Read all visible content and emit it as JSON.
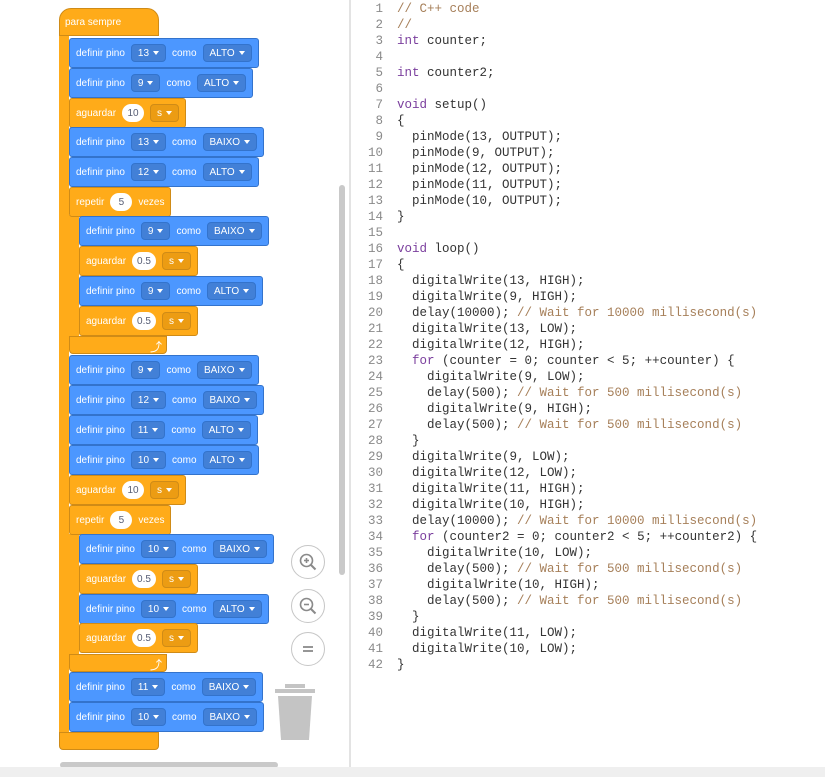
{
  "blocks": {
    "hat_label": "para sempre",
    "set_pin_label": "definir pino",
    "as_label": "como",
    "wait_label": "aguardar",
    "repeat_label": "repetir",
    "times_label": "vezes",
    "seconds_unit": "s",
    "rows": [
      {
        "kind": "pin",
        "pin": "13",
        "state": "ALTO"
      },
      {
        "kind": "pin",
        "pin": "9",
        "state": "ALTO"
      },
      {
        "kind": "wait",
        "value": "10"
      },
      {
        "kind": "pin",
        "pin": "13",
        "state": "BAIXO"
      },
      {
        "kind": "pin",
        "pin": "12",
        "state": "ALTO"
      },
      {
        "kind": "repeat",
        "count": "5"
      },
      {
        "kind": "pin",
        "pin": "9",
        "state": "BAIXO"
      },
      {
        "kind": "wait",
        "value": "0.5"
      },
      {
        "kind": "pin",
        "pin": "9",
        "state": "ALTO"
      },
      {
        "kind": "wait",
        "value": "0.5"
      },
      {
        "kind": "pin",
        "pin": "9",
        "state": "BAIXO"
      },
      {
        "kind": "pin",
        "pin": "12",
        "state": "BAIXO"
      },
      {
        "kind": "pin",
        "pin": "11",
        "state": "ALTO"
      },
      {
        "kind": "pin",
        "pin": "10",
        "state": "ALTO"
      },
      {
        "kind": "wait",
        "value": "10"
      },
      {
        "kind": "repeat",
        "count": "5"
      },
      {
        "kind": "pin",
        "pin": "10",
        "state": "BAIXO"
      },
      {
        "kind": "wait",
        "value": "0.5"
      },
      {
        "kind": "pin",
        "pin": "10",
        "state": "ALTO"
      },
      {
        "kind": "wait",
        "value": "0.5"
      },
      {
        "kind": "pin",
        "pin": "11",
        "state": "BAIXO"
      },
      {
        "kind": "pin",
        "pin": "10",
        "state": "BAIXO"
      }
    ]
  },
  "zoom": {
    "zoom_in": "zoom-in-icon",
    "zoom_out": "zoom-out-icon",
    "reset": "zoom-reset-icon"
  },
  "code": {
    "lines": [
      [
        [
          "comment",
          "// C++ code"
        ]
      ],
      [
        [
          "comment",
          "//"
        ]
      ],
      [
        [
          "kw",
          "int"
        ],
        [
          "plain",
          " counter;"
        ]
      ],
      [],
      [
        [
          "kw",
          "int"
        ],
        [
          "plain",
          " counter2;"
        ]
      ],
      [],
      [
        [
          "kw",
          "void"
        ],
        [
          "plain",
          " setup()"
        ]
      ],
      [
        [
          "plain",
          "{"
        ]
      ],
      [
        [
          "plain",
          "  pinMode(13, OUTPUT);"
        ]
      ],
      [
        [
          "plain",
          "  pinMode(9, OUTPUT);"
        ]
      ],
      [
        [
          "plain",
          "  pinMode(12, OUTPUT);"
        ]
      ],
      [
        [
          "plain",
          "  pinMode(11, OUTPUT);"
        ]
      ],
      [
        [
          "plain",
          "  pinMode(10, OUTPUT);"
        ]
      ],
      [
        [
          "plain",
          "}"
        ]
      ],
      [],
      [
        [
          "kw",
          "void"
        ],
        [
          "plain",
          " loop()"
        ]
      ],
      [
        [
          "plain",
          "{"
        ]
      ],
      [
        [
          "plain",
          "  digitalWrite(13, HIGH);"
        ]
      ],
      [
        [
          "plain",
          "  digitalWrite(9, HIGH);"
        ]
      ],
      [
        [
          "plain",
          "  delay(10000); "
        ],
        [
          "comment",
          "// Wait for 10000 millisecond(s)"
        ]
      ],
      [
        [
          "plain",
          "  digitalWrite(13, LOW);"
        ]
      ],
      [
        [
          "plain",
          "  digitalWrite(12, HIGH);"
        ]
      ],
      [
        [
          "plain",
          "  "
        ],
        [
          "kw",
          "for"
        ],
        [
          "plain",
          " (counter = 0; counter < 5; ++counter) {"
        ]
      ],
      [
        [
          "plain",
          "    digitalWrite(9, LOW);"
        ]
      ],
      [
        [
          "plain",
          "    delay(500); "
        ],
        [
          "comment",
          "// Wait for 500 millisecond(s)"
        ]
      ],
      [
        [
          "plain",
          "    digitalWrite(9, HIGH);"
        ]
      ],
      [
        [
          "plain",
          "    delay(500); "
        ],
        [
          "comment",
          "// Wait for 500 millisecond(s)"
        ]
      ],
      [
        [
          "plain",
          "  }"
        ]
      ],
      [
        [
          "plain",
          "  digitalWrite(9, LOW);"
        ]
      ],
      [
        [
          "plain",
          "  digitalWrite(12, LOW);"
        ]
      ],
      [
        [
          "plain",
          "  digitalWrite(11, HIGH);"
        ]
      ],
      [
        [
          "plain",
          "  digitalWrite(10, HIGH);"
        ]
      ],
      [
        [
          "plain",
          "  delay(10000); "
        ],
        [
          "comment",
          "// Wait for 10000 millisecond(s)"
        ]
      ],
      [
        [
          "plain",
          "  "
        ],
        [
          "kw",
          "for"
        ],
        [
          "plain",
          " (counter2 = 0; counter2 < 5; ++counter2) {"
        ]
      ],
      [
        [
          "plain",
          "    digitalWrite(10, LOW);"
        ]
      ],
      [
        [
          "plain",
          "    delay(500); "
        ],
        [
          "comment",
          "// Wait for 500 millisecond(s)"
        ]
      ],
      [
        [
          "plain",
          "    digitalWrite(10, HIGH);"
        ]
      ],
      [
        [
          "plain",
          "    delay(500); "
        ],
        [
          "comment",
          "// Wait for 500 millisecond(s)"
        ]
      ],
      [
        [
          "plain",
          "  }"
        ]
      ],
      [
        [
          "plain",
          "  digitalWrite(11, LOW);"
        ]
      ],
      [
        [
          "plain",
          "  digitalWrite(10, LOW);"
        ]
      ],
      [
        [
          "plain",
          "}"
        ]
      ]
    ]
  },
  "colors": {
    "block_blue": "#4c97ff",
    "block_orange": "#ffab19",
    "code_comment": "#a67f59",
    "code_keyword": "#7a3e9d"
  }
}
